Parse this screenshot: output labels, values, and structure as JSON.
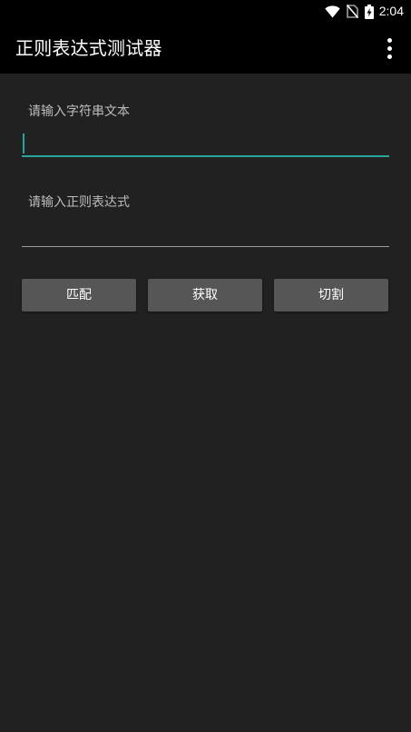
{
  "status_bar": {
    "time": "2:04",
    "icons": [
      "wifi-icon",
      "no-sim-icon",
      "battery-charging-icon"
    ]
  },
  "app_bar": {
    "title": "正则表达式测试器",
    "menu_icon": "more-vert-icon"
  },
  "form": {
    "text_label": "请输入字符串文本",
    "text_value": "",
    "regex_label": "请输入正则表达式",
    "regex_value": ""
  },
  "buttons": {
    "match": "匹配",
    "get": "获取",
    "split": "切割"
  },
  "colors": {
    "background": "#212121",
    "app_bar": "#000000",
    "accent": "#26a69a",
    "button": "#565656",
    "label": "#bdbdbd"
  }
}
